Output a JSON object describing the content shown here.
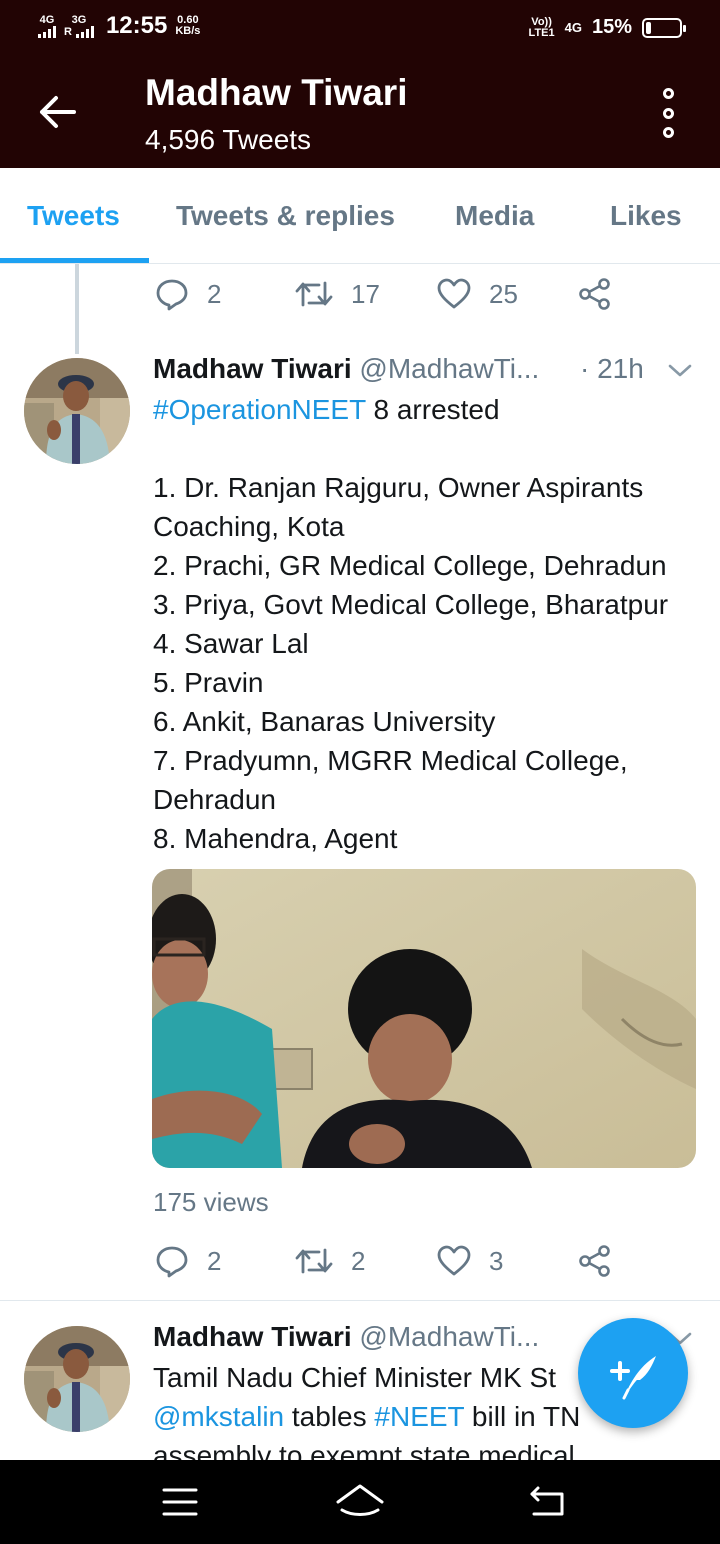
{
  "status_bar": {
    "network1": "4G",
    "network2": "3G",
    "network2_sub": "R",
    "time": "12:55",
    "speed_value": "0.60",
    "speed_unit": "KB/s",
    "volte_top": "Vo))",
    "volte_bottom": "LTE1",
    "data_type": "4G",
    "battery_pct": "15%",
    "battery_level": 0.15
  },
  "header": {
    "name": "Madhaw Tiwari",
    "tweet_count": "4,596 Tweets",
    "back_icon": "arrow-left-icon",
    "more_icon": "more-vertical-icon"
  },
  "tabs": [
    {
      "label": "Tweets",
      "active": true
    },
    {
      "label": "Tweets & replies",
      "active": false
    },
    {
      "label": "Media",
      "active": false
    },
    {
      "label": "Likes",
      "active": false
    }
  ],
  "prev_tweet_actions": {
    "replies": "2",
    "retweets": "17",
    "likes": "25"
  },
  "tweet1": {
    "name": "Madhaw Tiwari",
    "handle": "@MadhawTi...",
    "time": "· 21h",
    "hashtag": "#OperationNEET",
    "headline_rest": " 8 arrested",
    "lines": [
      "1. Dr. Ranjan Rajguru, Owner Aspirants",
      "Coaching, Kota",
      "2. Prachi, GR Medical College, Dehradun",
      "3. Priya, Govt Medical College, Bharatpur",
      "4. Sawar Lal",
      "5. Pravin",
      "6. Ankit, Banaras University",
      "7. Pradyumn, MGRR Medical College,",
      "Dehradun",
      "8. Mahendra, Agent"
    ],
    "views": "175 views",
    "replies": "2",
    "retweets": "2",
    "likes": "3"
  },
  "tweet2": {
    "name": "Madhaw Tiwari",
    "handle": "@MadhawTi...",
    "line1": "Tamil Nadu Chief Minister MK St",
    "mention": "@mkstalin",
    "line2_mid": " tables ",
    "hashtag": "#NEET",
    "line2_end": " bill in TN",
    "line3": "assembly to exempt state medical"
  },
  "colors": {
    "header_bg": "#220404",
    "accent": "#1da1f2",
    "link": "#1b95e0",
    "secondary_text": "#657786"
  },
  "icons": {
    "reply": "reply-icon",
    "retweet": "retweet-icon",
    "like": "heart-icon",
    "share": "share-icon",
    "compose": "compose-tweet-icon",
    "nav_menu": "menu-icon",
    "nav_home": "home-icon",
    "nav_back": "back-icon"
  }
}
